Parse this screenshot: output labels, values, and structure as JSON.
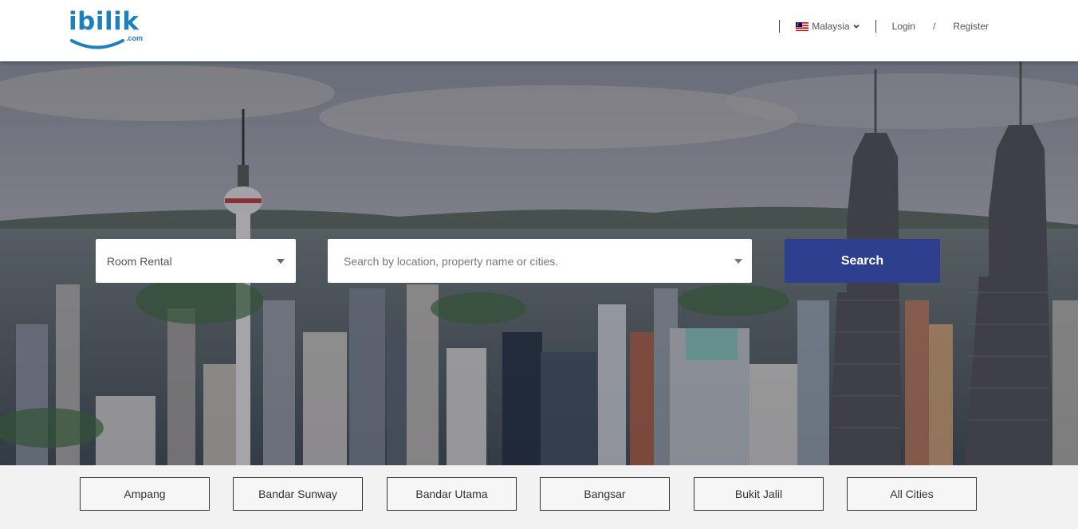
{
  "header": {
    "logo": {
      "text": "ibilik",
      "suffix": ".com"
    },
    "country": {
      "label": "Malaysia"
    },
    "login_label": "Login",
    "separator": "/",
    "register_label": "Register"
  },
  "search": {
    "category": {
      "selected": "Room Rental"
    },
    "location": {
      "placeholder": "Search by location, property name or cities."
    },
    "button_label": "Search"
  },
  "cities": [
    {
      "label": "Ampang"
    },
    {
      "label": "Bandar Sunway"
    },
    {
      "label": "Bandar Utama"
    },
    {
      "label": "Bangsar"
    },
    {
      "label": "Bukit Jalil"
    },
    {
      "label": "All Cities"
    }
  ],
  "colors": {
    "brand_blue": "#1e7fc0",
    "search_button": "#2f3f8f"
  },
  "icons": {
    "flag": "malaysia-flag-icon",
    "chevron": "chevron-down-icon",
    "caret": "caret-down-icon"
  }
}
